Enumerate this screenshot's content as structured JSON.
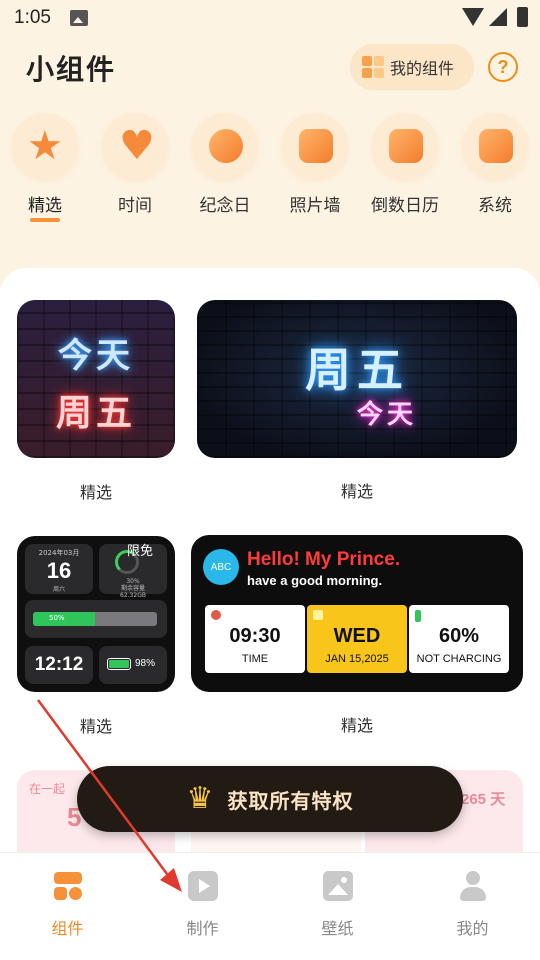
{
  "status_bar": {
    "time": "1:05"
  },
  "header": {
    "title": "小组件",
    "my_widgets_label": "我的组件",
    "help_symbol": "?"
  },
  "categories": [
    {
      "label": "精选",
      "icon": "star-icon",
      "active": true
    },
    {
      "label": "时间",
      "icon": "heart-icon",
      "active": false
    },
    {
      "label": "纪念日",
      "icon": "clock-icon",
      "active": false
    },
    {
      "label": "照片墙",
      "icon": "photo-icon",
      "active": false
    },
    {
      "label": "倒数日历",
      "icon": "calendar-icon",
      "active": false
    },
    {
      "label": "系统",
      "icon": "chart-icon",
      "active": false
    }
  ],
  "widgets": {
    "neon_square": {
      "line1": "今天",
      "line2": "周五",
      "label": "精选"
    },
    "neon_wide": {
      "line1": "周五",
      "line2": "今天",
      "label": "精选"
    },
    "dashboard": {
      "date_small": "2024年03月",
      "date_big": "16",
      "weekday": "周六",
      "storage_percent": "30%",
      "storage_text_line1": "剩余容量",
      "storage_text_line2": "62.32GB",
      "badge": "限免",
      "volume_text": "50%",
      "volume_level": 0.5,
      "clock": "12:12",
      "battery_text": "98%",
      "battery_level": 0.98,
      "label": "精选"
    },
    "hello": {
      "avatar_text": "ABC",
      "greeting": "Hello!  My Prince.",
      "sub": "have a good morning.",
      "time_value": "09:30",
      "time_label": "TIME",
      "day_value": "WED",
      "day_label": "JAN 15,2025",
      "battery_value": "60%",
      "battery_label": "NOT CHARCING",
      "label": "精选"
    },
    "row3": {
      "left_text": "在一起",
      "left_number": "5",
      "right_number": "265 天"
    }
  },
  "promo": {
    "label": "获取所有特权",
    "icon": "crown-icon"
  },
  "bottom_nav": [
    {
      "label": "组件",
      "icon": "widgets-icon",
      "active": true
    },
    {
      "label": "制作",
      "icon": "play-icon",
      "active": false
    },
    {
      "label": "壁纸",
      "icon": "wallpaper-icon",
      "active": false
    },
    {
      "label": "我的",
      "icon": "profile-icon",
      "active": false
    }
  ],
  "colors": {
    "accent": "#f6913a",
    "background": "#fdf3e3",
    "promo_bg": "#221b14",
    "annotation_arrow": "#e03a2e"
  }
}
